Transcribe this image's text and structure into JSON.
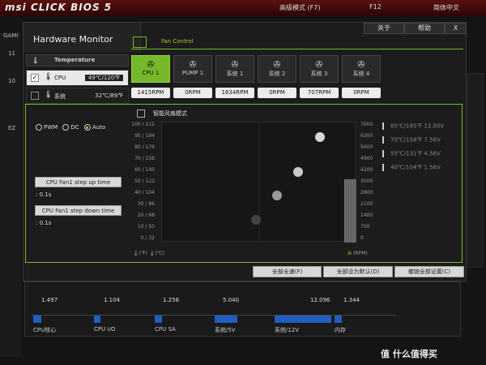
{
  "topbar": {
    "logo": "msi CLICK BIOS 5",
    "mode": "高级模式 (F7)",
    "f12": "F12",
    "lang": "简体中文"
  },
  "background": {
    "left_labels": [
      "GAMI",
      "11",
      "10",
      "EZ"
    ]
  },
  "dialog": {
    "title": "Hardware Monitor",
    "about": "关于",
    "help": "帮助",
    "close": "X",
    "fan_control_tab": "Fan Control"
  },
  "temperature": {
    "header": "Temperature",
    "rows": [
      {
        "label": "CPU",
        "value": "49℃/120℉",
        "checked": true
      },
      {
        "label": "系统",
        "value": "32℃/89℉",
        "checked": false
      }
    ]
  },
  "fans": [
    {
      "label": "CPU 1",
      "rpm": "1415RPM",
      "active": true
    },
    {
      "label": "PUMP 1",
      "rpm": "0RPM",
      "active": false
    },
    {
      "label": "系统 1",
      "rpm": "1634RPM",
      "active": false
    },
    {
      "label": "系统 2",
      "rpm": "0RPM",
      "active": false
    },
    {
      "label": "系统 3",
      "rpm": "707RPM",
      "active": false
    },
    {
      "label": "系统 4",
      "rpm": "0RPM",
      "active": false
    }
  ],
  "modes": {
    "pwm": "PWM",
    "dc": "DC",
    "auto": "Auto",
    "selected": "Auto"
  },
  "step_up": {
    "label": "CPU Fan1 step up time",
    "value": ": 0.1s"
  },
  "step_down": {
    "label": "CPU Fan1 step down time",
    "value": ": 0.1s"
  },
  "smart_mode": "智能风扇模式",
  "graph": {
    "temp_axis": [
      "100 / 212",
      "90 / 194",
      "80 / 176",
      "70 / 158",
      "60 / 140",
      "50 / 122",
      "40 / 104",
      "30 / 86",
      "20 / 68",
      "10 / 50",
      "0 / 32"
    ],
    "rpm_axis": [
      "7000",
      "6300",
      "5600",
      "4900",
      "4200",
      "3500",
      "2800",
      "2100",
      "1400",
      "700",
      "0"
    ],
    "temp_unit_label": "(℉)",
    "temp_unit_label2": "(℃)",
    "rpm_unit": "(RPM)"
  },
  "voltage_thresholds": [
    {
      "temp": "85℃/185℉",
      "volt": "12.00V"
    },
    {
      "temp": "70℃/158℉",
      "volt": "7.56V"
    },
    {
      "temp": "55℃/131℉",
      "volt": "4.56V"
    },
    {
      "temp": "40℃/104℉",
      "volt": "1.56V"
    }
  ],
  "footer": {
    "full_speed": "全部全速(F)",
    "default": "全部设为默认(D)",
    "undo": "撤销全部设置(C)"
  },
  "voltages": [
    {
      "label": "CPU核心",
      "value": "1.497"
    },
    {
      "label": "CPU I/O",
      "value": "1.104"
    },
    {
      "label": "CPU SA",
      "value": "1.256"
    },
    {
      "label": "系统/5V",
      "value": "5.040"
    },
    {
      "label": "系统/12V",
      "value": "12.096"
    },
    {
      "label": "内存",
      "value": "1.344"
    }
  ],
  "watermark": "值 什么值得买",
  "colors": {
    "accent": "#76b82a",
    "bar": "#1f5fc2",
    "brand": "#8b1a1a"
  }
}
